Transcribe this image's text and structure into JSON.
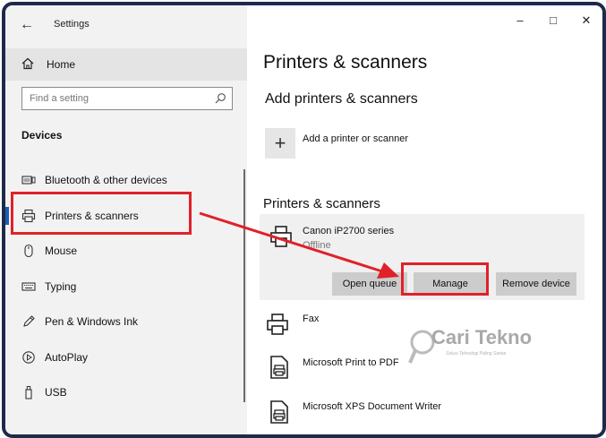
{
  "window": {
    "title": "Settings",
    "controls": {
      "minimize": "–",
      "maximize": "□",
      "close": "✕"
    }
  },
  "sidebar": {
    "home_label": "Home",
    "search_placeholder": "Find a setting",
    "section_title": "Devices",
    "items": [
      {
        "label": "Bluetooth & other devices",
        "icon": "bluetooth-devices-icon",
        "selected": false
      },
      {
        "label": "Printers & scanners",
        "icon": "printer-icon",
        "selected": true
      },
      {
        "label": "Mouse",
        "icon": "mouse-icon",
        "selected": false
      },
      {
        "label": "Typing",
        "icon": "keyboard-icon",
        "selected": false
      },
      {
        "label": "Pen & Windows Ink",
        "icon": "pen-icon",
        "selected": false
      },
      {
        "label": "AutoPlay",
        "icon": "autoplay-icon",
        "selected": false
      },
      {
        "label": "USB",
        "icon": "usb-icon",
        "selected": false
      }
    ]
  },
  "main": {
    "page_title": "Printers & scanners",
    "add_section_title": "Add printers & scanners",
    "add_label": "Add a printer or scanner",
    "list_section_title": "Printers & scanners",
    "printers": [
      {
        "name": "Canon iP2700 series",
        "status": "Offline",
        "expanded": true,
        "icon": "printer-icon"
      },
      {
        "name": "Fax",
        "icon": "fax-icon"
      },
      {
        "name": "Microsoft Print to PDF",
        "icon": "pdf-printer-icon"
      },
      {
        "name": "Microsoft XPS Document Writer",
        "icon": "xps-printer-icon"
      }
    ],
    "buttons": {
      "open_queue": "Open queue",
      "manage": "Manage",
      "remove": "Remove device"
    }
  },
  "watermark": {
    "brand": "Cari Tekno",
    "tagline": "Solusi Teknologi Paling Santai"
  },
  "colors": {
    "highlight_red": "#e0212a",
    "frame": "#1e2a4a",
    "selection_accent": "#1a5fb4"
  }
}
